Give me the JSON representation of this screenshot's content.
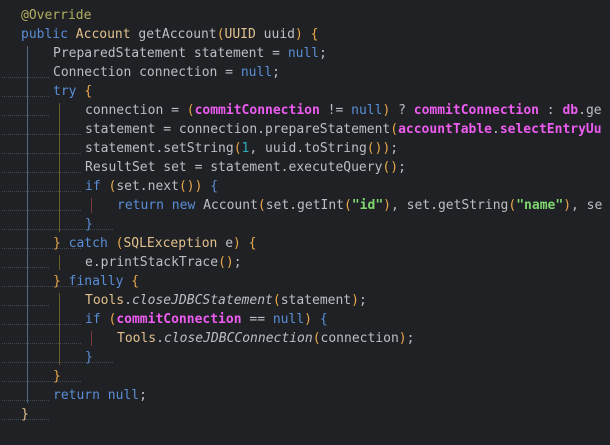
{
  "editor": {
    "language": "java",
    "background": "#1f2124",
    "lines": [
      {
        "indent": 0,
        "tokens": [
          {
            "t": "@Override",
            "k": "annotation"
          }
        ]
      },
      {
        "indent": 0,
        "tokens": [
          {
            "t": "public ",
            "k": "keyword"
          },
          {
            "t": "Account ",
            "k": "type"
          },
          {
            "t": "getAccount",
            "k": "plain"
          },
          {
            "t": "(",
            "k": "paren"
          },
          {
            "t": "UUID ",
            "k": "type"
          },
          {
            "t": "uuid",
            "k": "plain"
          },
          {
            "t": ") {",
            "k": "paren"
          }
        ]
      },
      {
        "indent": 1,
        "tokens": [
          {
            "t": "PreparedStatement statement = ",
            "k": "plain"
          },
          {
            "t": "null",
            "k": "keyword"
          },
          {
            "t": ";",
            "k": "plain"
          }
        ]
      },
      {
        "indent": 1,
        "tokens": [
          {
            "t": "Connection connection = ",
            "k": "plain"
          },
          {
            "t": "null",
            "k": "keyword"
          },
          {
            "t": ";",
            "k": "plain"
          }
        ]
      },
      {
        "indent": 1,
        "tokens": [
          {
            "t": "try ",
            "k": "keyword"
          },
          {
            "t": "{",
            "k": "paren"
          }
        ]
      },
      {
        "indent": 2,
        "tokens": [
          {
            "t": "connection = ",
            "k": "plain"
          },
          {
            "t": "(",
            "k": "paren"
          },
          {
            "t": "commitConnection",
            "k": "field"
          },
          {
            "t": " != ",
            "k": "plain"
          },
          {
            "t": "null",
            "k": "keyword"
          },
          {
            "t": ")",
            "k": "paren"
          },
          {
            "t": " ? ",
            "k": "plain"
          },
          {
            "t": "commitConnection",
            "k": "field"
          },
          {
            "t": " : ",
            "k": "plain"
          },
          {
            "t": "db",
            "k": "field"
          },
          {
            "t": ".ge",
            "k": "plain"
          }
        ]
      },
      {
        "indent": 2,
        "tokens": [
          {
            "t": "statement = connection.prepareStatement",
            "k": "plain"
          },
          {
            "t": "(",
            "k": "paren"
          },
          {
            "t": "accountTable",
            "k": "field"
          },
          {
            "t": ".",
            "k": "plain"
          },
          {
            "t": "selectEntryUu",
            "k": "field"
          }
        ]
      },
      {
        "indent": 2,
        "tokens": [
          {
            "t": "statement.setString",
            "k": "plain"
          },
          {
            "t": "(",
            "k": "paren"
          },
          {
            "t": "1",
            "k": "number"
          },
          {
            "t": ", uuid.toString",
            "k": "plain"
          },
          {
            "t": "()",
            "k": "paren"
          },
          {
            "t": ")",
            "k": "paren"
          },
          {
            "t": ";",
            "k": "plain"
          }
        ]
      },
      {
        "indent": 2,
        "tokens": [
          {
            "t": "ResultSet set = statement.executeQuery",
            "k": "plain"
          },
          {
            "t": "()",
            "k": "paren"
          },
          {
            "t": ";",
            "k": "plain"
          }
        ]
      },
      {
        "indent": 2,
        "tokens": [
          {
            "t": "if ",
            "k": "keyword"
          },
          {
            "t": "(",
            "k": "paren"
          },
          {
            "t": "set.next",
            "k": "plain"
          },
          {
            "t": "()",
            "k": "paren"
          },
          {
            "t": ") ",
            "k": "paren"
          },
          {
            "t": "{",
            "k": "keyword"
          }
        ]
      },
      {
        "indent": 3,
        "tokens": [
          {
            "t": "return ",
            "k": "keyword"
          },
          {
            "t": "new ",
            "k": "keyword"
          },
          {
            "t": "Account",
            "k": "plain"
          },
          {
            "t": "(",
            "k": "paren"
          },
          {
            "t": "set.getInt",
            "k": "plain"
          },
          {
            "t": "(",
            "k": "paren"
          },
          {
            "t": "\"id\"",
            "k": "string"
          },
          {
            "t": ")",
            "k": "paren"
          },
          {
            "t": ", set.getString",
            "k": "plain"
          },
          {
            "t": "(",
            "k": "paren"
          },
          {
            "t": "\"name\"",
            "k": "string"
          },
          {
            "t": ")",
            "k": "paren"
          },
          {
            "t": ", se",
            "k": "plain"
          }
        ]
      },
      {
        "indent": 2,
        "tokens": [
          {
            "t": "}",
            "k": "keyword"
          }
        ]
      },
      {
        "indent": 1,
        "tokens": [
          {
            "t": "} ",
            "k": "paren"
          },
          {
            "t": "catch ",
            "k": "keyword"
          },
          {
            "t": "(",
            "k": "paren"
          },
          {
            "t": "SQLException ",
            "k": "type"
          },
          {
            "t": "e",
            "k": "plain"
          },
          {
            "t": ") {",
            "k": "paren"
          }
        ]
      },
      {
        "indent": 2,
        "tokens": [
          {
            "t": "e.printStackTrace",
            "k": "plain"
          },
          {
            "t": "()",
            "k": "paren"
          },
          {
            "t": ";",
            "k": "plain"
          }
        ]
      },
      {
        "indent": 1,
        "tokens": [
          {
            "t": "} ",
            "k": "paren"
          },
          {
            "t": "finally ",
            "k": "keyword"
          },
          {
            "t": "{",
            "k": "paren"
          }
        ]
      },
      {
        "indent": 2,
        "tokens": [
          {
            "t": "Tools",
            "k": "type"
          },
          {
            "t": ".",
            "k": "plain"
          },
          {
            "t": "closeJDBCStatement",
            "k": "italic"
          },
          {
            "t": "(",
            "k": "paren"
          },
          {
            "t": "statement",
            "k": "plain"
          },
          {
            "t": ")",
            "k": "paren"
          },
          {
            "t": ";",
            "k": "plain"
          }
        ]
      },
      {
        "indent": 2,
        "tokens": [
          {
            "t": "if ",
            "k": "keyword"
          },
          {
            "t": "(",
            "k": "paren"
          },
          {
            "t": "commitConnection",
            "k": "field"
          },
          {
            "t": " == ",
            "k": "plain"
          },
          {
            "t": "null",
            "k": "keyword"
          },
          {
            "t": ") ",
            "k": "paren"
          },
          {
            "t": "{",
            "k": "keyword"
          }
        ]
      },
      {
        "indent": 3,
        "tokens": [
          {
            "t": "Tools",
            "k": "type"
          },
          {
            "t": ".",
            "k": "plain"
          },
          {
            "t": "closeJDBCConnection",
            "k": "italic"
          },
          {
            "t": "(",
            "k": "paren"
          },
          {
            "t": "connection",
            "k": "plain"
          },
          {
            "t": ")",
            "k": "paren"
          },
          {
            "t": ";",
            "k": "plain"
          }
        ]
      },
      {
        "indent": 2,
        "tokens": [
          {
            "t": "}",
            "k": "keyword"
          }
        ]
      },
      {
        "indent": 1,
        "tokens": [
          {
            "t": "}",
            "k": "paren"
          }
        ]
      },
      {
        "indent": 1,
        "tokens": [
          {
            "t": "return ",
            "k": "keyword"
          },
          {
            "t": "null",
            "k": "keyword"
          },
          {
            "t": ";",
            "k": "plain"
          }
        ]
      },
      {
        "indent": 0,
        "tokens": [
          {
            "t": "}",
            "k": "type"
          }
        ]
      }
    ]
  }
}
